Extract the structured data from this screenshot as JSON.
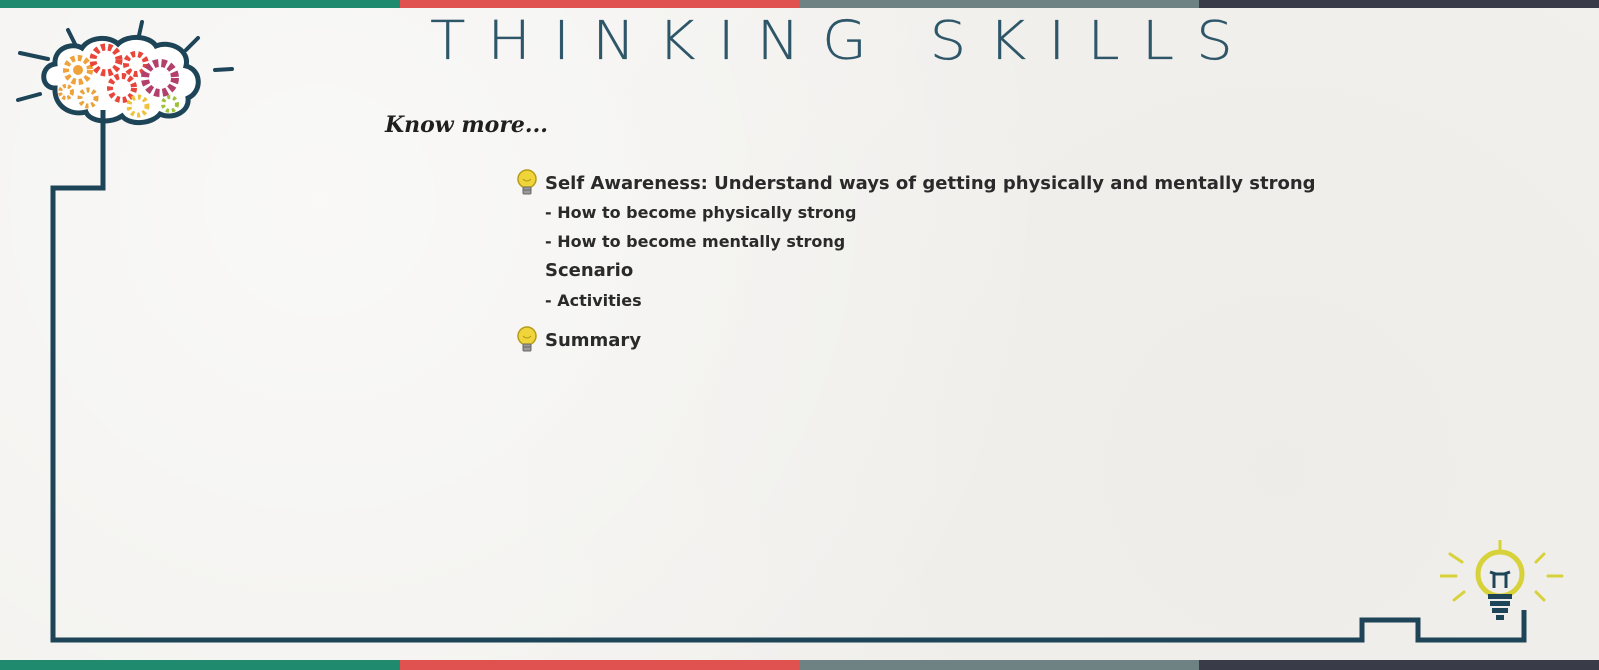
{
  "slide": {
    "title": "THINKING SKILLS",
    "subtitle": "Know more...",
    "colors": {
      "title": "#2e5669",
      "circuit_line": "#1d4557",
      "stripe": [
        "#1f8a6e",
        "#e0524f",
        "#6f8283",
        "#3a3b48"
      ],
      "bulb_yellow": "#e7d63a"
    }
  },
  "content": {
    "items": [
      {
        "icon": "lightbulb-icon",
        "label": "Self Awareness: Understand ways of getting physically and mentally strong",
        "subitems": [
          "- How to become physically strong",
          "- How to become mentally strong"
        ],
        "section_heading": "Scenario",
        "section_subitems": [
          "- Activities"
        ]
      },
      {
        "icon": "lightbulb-icon",
        "label": "Summary"
      }
    ]
  },
  "decorations": {
    "top_left": "brain-gears-icon",
    "bottom_right": "glowing-lightbulb-icon"
  }
}
